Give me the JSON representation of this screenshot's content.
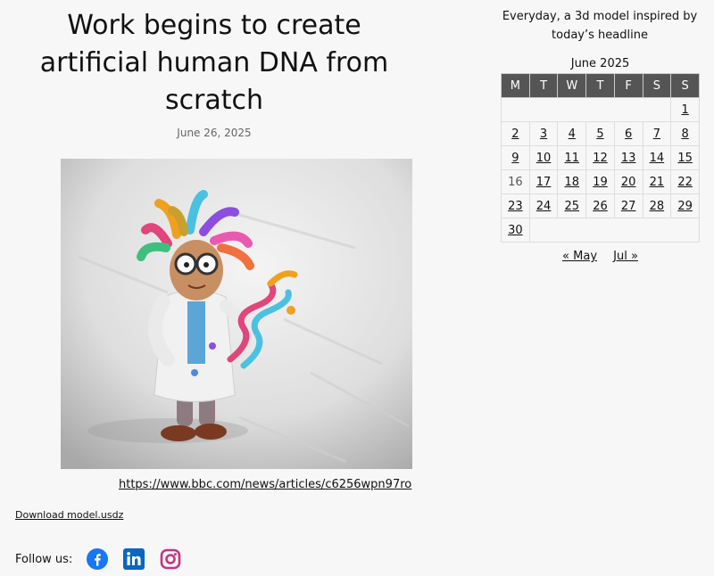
{
  "article": {
    "title": "Work begins to create artificial human DNA from scratch",
    "date": "June 26, 2025",
    "source_url": "https://www.bbc.com/news/articles/c6256wpn97ro",
    "download_label": "Download model.usdz"
  },
  "follow": {
    "label": "Follow us:",
    "icons": [
      "facebook-icon",
      "linkedin-icon",
      "instagram-icon"
    ],
    "colors": {
      "facebook": "#1877f2",
      "linkedin": "#0a66c2",
      "instagram": "#c13584"
    }
  },
  "sidebar": {
    "tagline": "Everyday, a 3d model inspired by today’s headline"
  },
  "calendar": {
    "caption": "June 2025",
    "weekdays": [
      "M",
      "T",
      "W",
      "T",
      "F",
      "S",
      "S"
    ],
    "weeks": [
      [
        "",
        "",
        "",
        "",
        "",
        "",
        "1"
      ],
      [
        "2",
        "3",
        "4",
        "5",
        "6",
        "7",
        "8"
      ],
      [
        "9",
        "10",
        "11",
        "12",
        "13",
        "14",
        "15"
      ],
      [
        "16",
        "17",
        "18",
        "19",
        "20",
        "21",
        "22"
      ],
      [
        "23",
        "24",
        "25",
        "26",
        "27",
        "28",
        "29"
      ],
      [
        "30",
        "",
        "",
        "",
        "",
        "",
        ""
      ]
    ],
    "unlinked_days": [
      "16"
    ],
    "prev_label": "« May",
    "next_label": "Jul »",
    "header_color": "#555555"
  }
}
